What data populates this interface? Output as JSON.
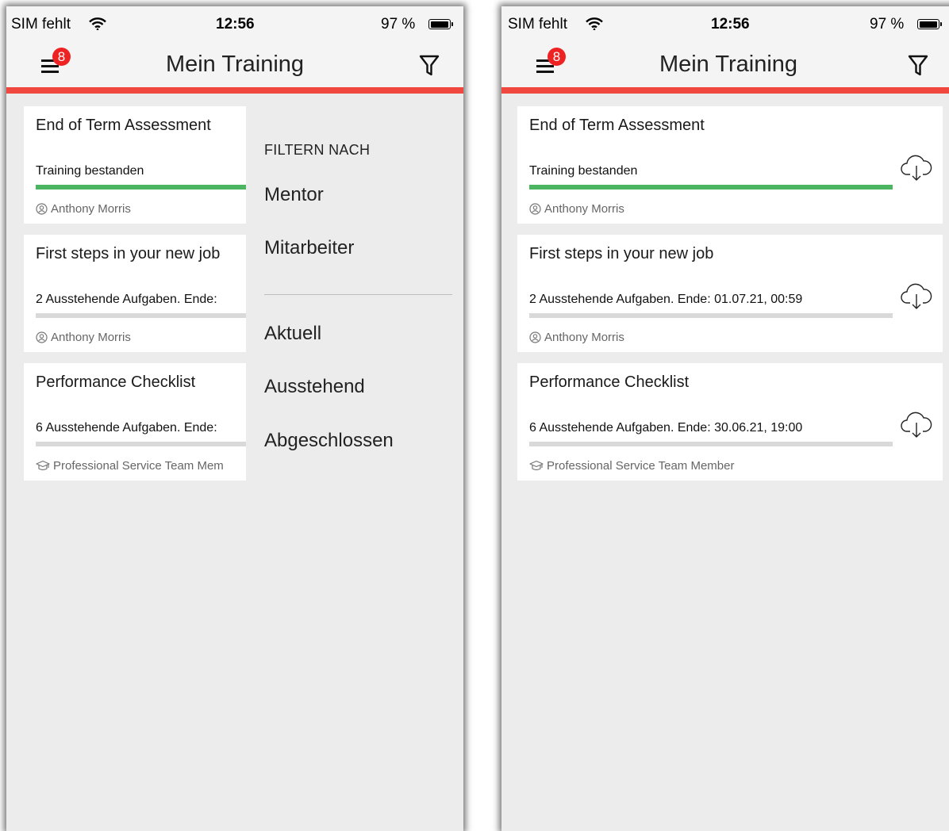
{
  "status_bar": {
    "carrier": "SIM fehlt",
    "time": "12:56",
    "battery_percent": "97 %"
  },
  "nav": {
    "title": "Mein Training",
    "badge_count": "8",
    "menu_icon": "hamburger-menu-icon",
    "filter_icon": "funnel-filter-icon"
  },
  "colors": {
    "accent_red": "#f0483e",
    "badge_red": "#ee2222",
    "progress_green": "#4cb561",
    "progress_track": "#d9d9d9",
    "background": "#ececec"
  },
  "left_cards": [
    {
      "title": "End of Term Assessment",
      "status": "Training bestanden",
      "progress": 1.0,
      "meta_icon": "mentor-person-icon",
      "meta": "Anthony Morris"
    },
    {
      "title": "First steps in your new job",
      "status": "2 Ausstehende Aufgaben. Ende:",
      "progress": 0,
      "meta_icon": "mentor-person-icon",
      "meta": "Anthony Morris"
    },
    {
      "title": "Performance Checklist",
      "status": "6 Ausstehende Aufgaben. Ende:",
      "progress": 0,
      "meta_icon": "graduation-cap-icon",
      "meta": "Professional Service Team Mem"
    }
  ],
  "filter_menu": {
    "heading": "FILTERN NACH",
    "group_by": [
      "Mentor",
      "Mitarbeiter"
    ],
    "status": [
      "Aktuell",
      "Ausstehend",
      "Abgeschlossen"
    ]
  },
  "right_cards": [
    {
      "title": "End of Term Assessment",
      "status": "Training bestanden",
      "progress": 1.0,
      "meta_icon": "mentor-person-icon",
      "meta": "Anthony Morris",
      "download_icon": "cloud-download-icon"
    },
    {
      "title": "First steps in your new job",
      "status": "2 Ausstehende Aufgaben. Ende: 01.07.21, 00:59",
      "progress": 0,
      "meta_icon": "mentor-person-icon",
      "meta": "Anthony Morris",
      "download_icon": "cloud-download-icon"
    },
    {
      "title": "Performance Checklist",
      "status": "6 Ausstehende Aufgaben. Ende: 30.06.21, 19:00",
      "progress": 0,
      "meta_icon": "graduation-cap-icon",
      "meta": "Professional Service Team Member",
      "download_icon": "cloud-download-icon"
    }
  ]
}
